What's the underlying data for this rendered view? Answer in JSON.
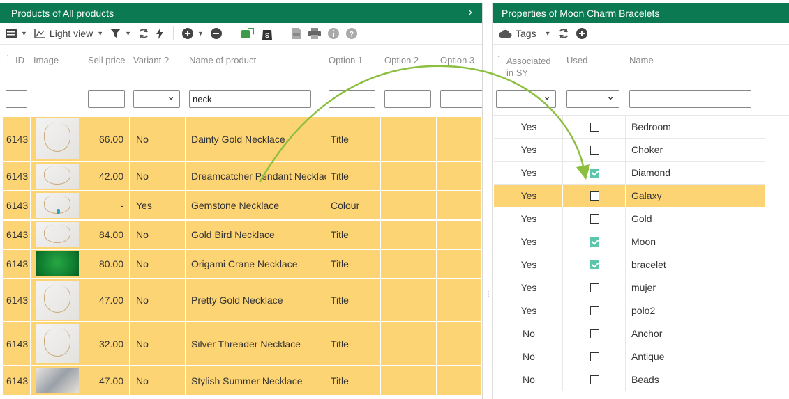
{
  "left": {
    "title": "Products of All products",
    "toolbar": {
      "view_label": "Light view"
    },
    "columns": {
      "id": "ID",
      "image": "Image",
      "sell_price": "Sell price",
      "variant": "Variant ?",
      "name": "Name of product",
      "opt1": "Option 1",
      "opt2": "Option 2",
      "opt3": "Option 3"
    },
    "filters": {
      "name_value": "neck"
    },
    "rows": [
      {
        "id": "6143",
        "price": "66.00",
        "variant": "No",
        "name": "Dainty Gold Necklace",
        "opt1": "Title",
        "thumb": "necklace"
      },
      {
        "id": "6143",
        "price": "42.00",
        "variant": "No",
        "name": "Dreamcatcher Pendant Necklace",
        "opt1": "Title",
        "thumb": "necklace"
      },
      {
        "id": "6143",
        "price": "-",
        "variant": "Yes",
        "name": "Gemstone Necklace",
        "opt1": "Colour",
        "thumb": "gemstone"
      },
      {
        "id": "6143",
        "price": "84.00",
        "variant": "No",
        "name": "Gold Bird Necklace",
        "opt1": "Title",
        "thumb": "necklace"
      },
      {
        "id": "6143",
        "price": "80.00",
        "variant": "No",
        "name": "Origami Crane Necklace",
        "opt1": "Title",
        "thumb": "green"
      },
      {
        "id": "6143",
        "price": "47.00",
        "variant": "No",
        "name": "Pretty Gold Necklace",
        "opt1": "Title",
        "thumb": "necklace"
      },
      {
        "id": "6143",
        "price": "32.00",
        "variant": "No",
        "name": "Silver Threader Necklace",
        "opt1": "Title",
        "thumb": "necklace"
      },
      {
        "id": "6143",
        "price": "47.00",
        "variant": "No",
        "name": "Stylish Summer Necklace",
        "opt1": "Title",
        "thumb": "busy"
      }
    ]
  },
  "right": {
    "title": "Properties of Moon Charm Bracelets",
    "toolbar": {
      "tags_label": "Tags"
    },
    "columns": {
      "assoc_line1": "Associated",
      "assoc_line2": "in SY",
      "used": "Used",
      "name": "Name"
    },
    "rows": [
      {
        "assoc": "Yes",
        "used": false,
        "name": "Bedroom"
      },
      {
        "assoc": "Yes",
        "used": false,
        "name": "Choker"
      },
      {
        "assoc": "Yes",
        "used": true,
        "name": "Diamond"
      },
      {
        "assoc": "Yes",
        "used": false,
        "name": "Galaxy",
        "highlight": true
      },
      {
        "assoc": "Yes",
        "used": false,
        "name": "Gold"
      },
      {
        "assoc": "Yes",
        "used": true,
        "name": "Moon"
      },
      {
        "assoc": "Yes",
        "used": true,
        "name": "bracelet"
      },
      {
        "assoc": "Yes",
        "used": false,
        "name": "mujer"
      },
      {
        "assoc": "Yes",
        "used": false,
        "name": "polo2"
      },
      {
        "assoc": "No",
        "used": false,
        "name": "Anchor"
      },
      {
        "assoc": "No",
        "used": false,
        "name": "Antique"
      },
      {
        "assoc": "No",
        "used": false,
        "name": "Beads"
      }
    ]
  },
  "colors": {
    "header": "#0b7a52",
    "row_highlight": "#fdd474",
    "checkbox_checked": "#5cc6ad",
    "arrow": "#8cbf3f"
  }
}
